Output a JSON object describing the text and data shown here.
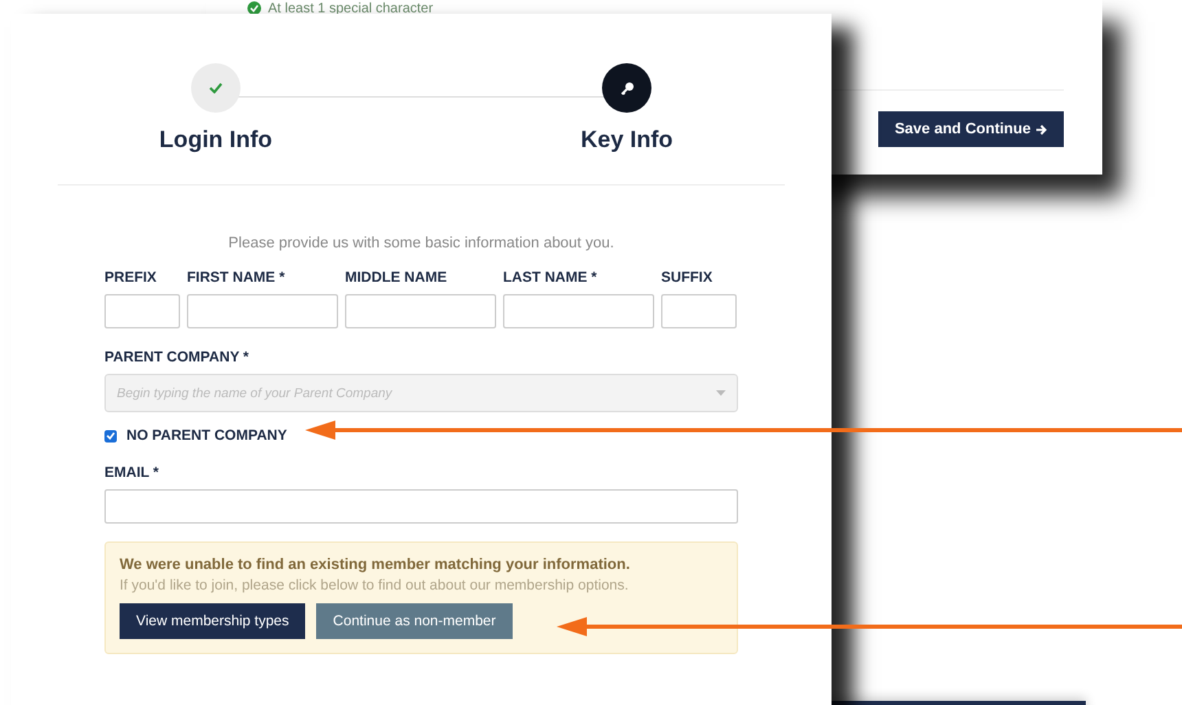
{
  "back_panel": {
    "requirement": {
      "text": "At least 1 special character",
      "met": true
    },
    "save_button": {
      "label": "Save and Continue"
    }
  },
  "steps": [
    {
      "label": "Login Info",
      "completed": true,
      "selected": false
    },
    {
      "label": "Key Info",
      "completed": false,
      "selected": true
    }
  ],
  "form": {
    "intro": "Please provide us with some basic information about you.",
    "name_fields": [
      {
        "label": "PREFIX"
      },
      {
        "label": "FIRST NAME *"
      },
      {
        "label": "MIDDLE NAME"
      },
      {
        "label": "LAST NAME *"
      },
      {
        "label": "SUFFIX"
      }
    ],
    "parent_company": {
      "label": "PARENT COMPANY *",
      "placeholder": "Begin typing the name of your Parent Company",
      "disabled": true
    },
    "no_parent_company": {
      "label": "NO PARENT COMPANY",
      "checked": true
    },
    "email": {
      "label": "EMAIL *"
    },
    "alert": {
      "title": "We were unable to find an existing member matching your information.",
      "message": "If you'd like to join, please click below to find out about our membership options.",
      "buttons": [
        {
          "label": "View membership types",
          "kind": "primary"
        },
        {
          "label": "Continue as non-member",
          "kind": "secondary"
        }
      ]
    }
  }
}
